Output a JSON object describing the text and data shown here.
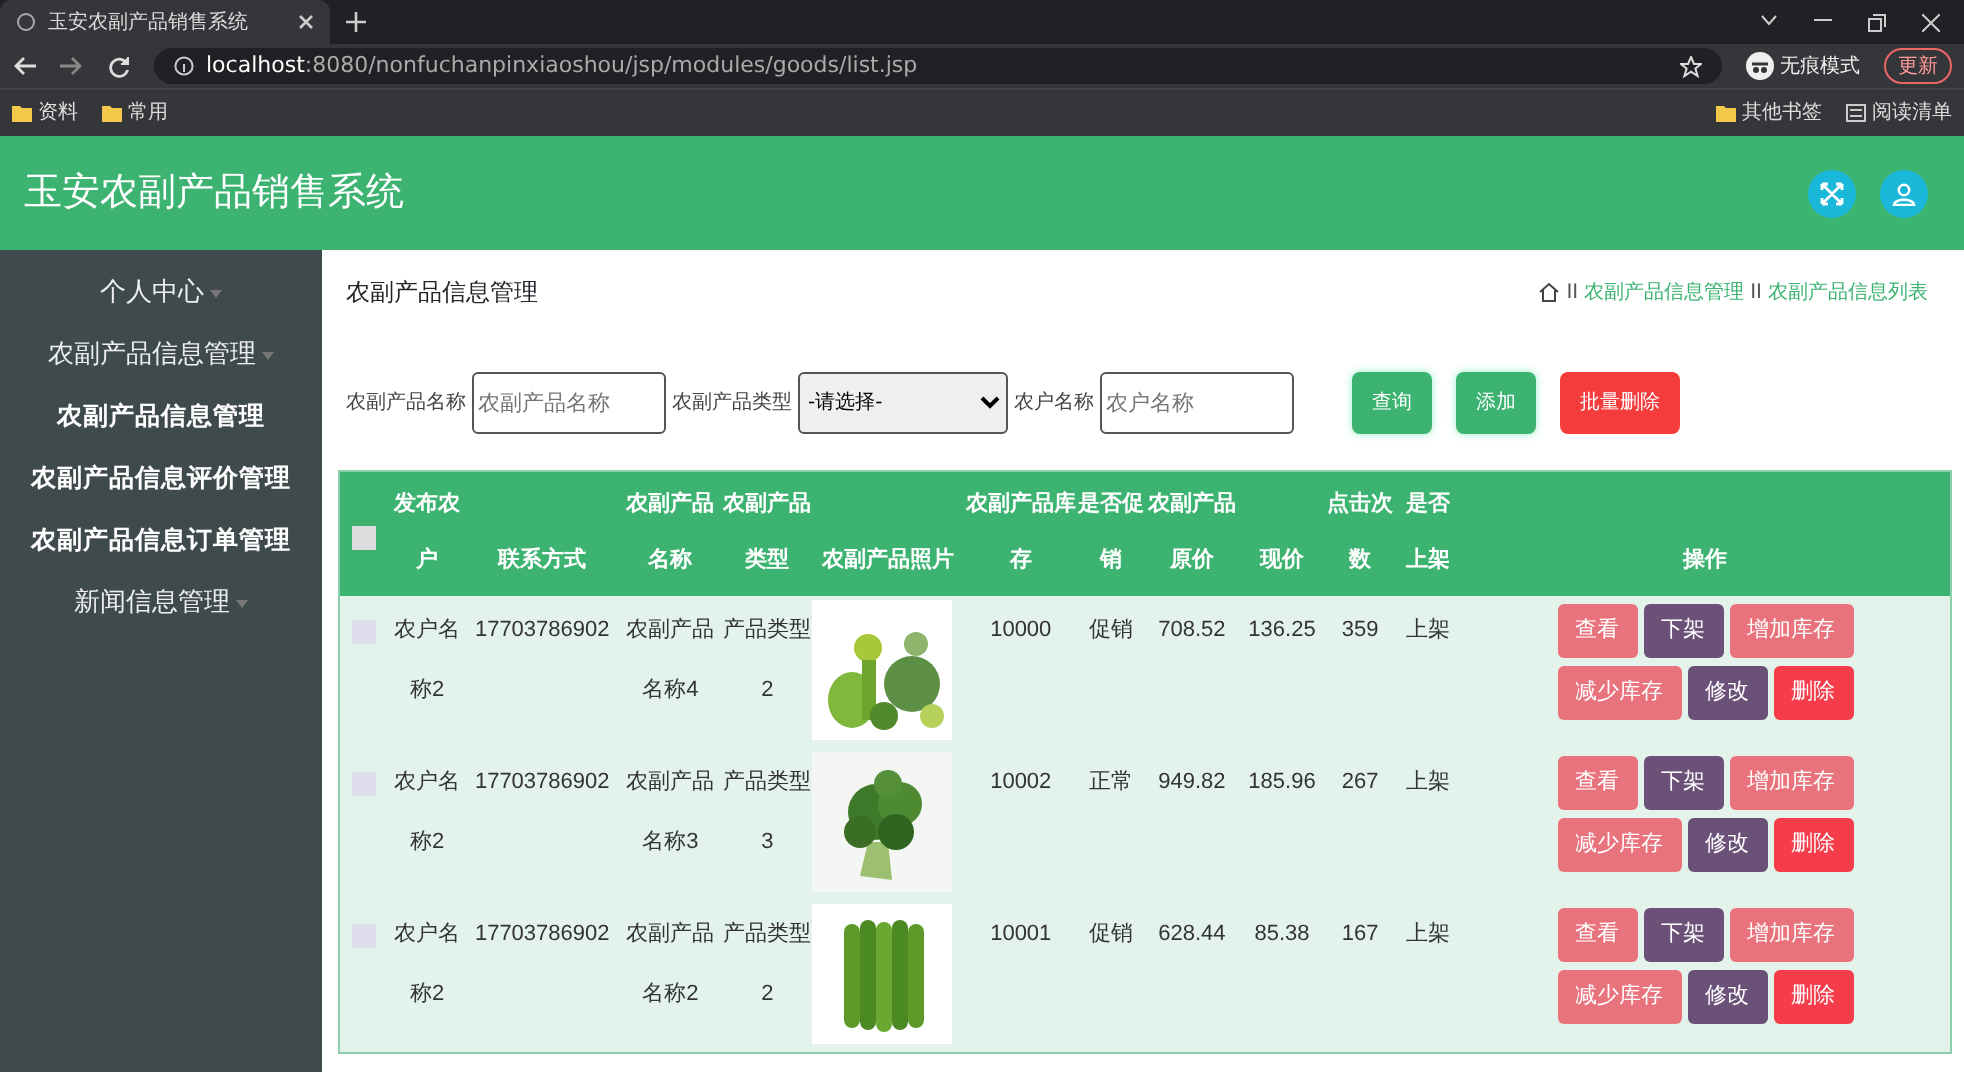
{
  "browser": {
    "tab_title": "玉安农副产品销售系统",
    "url_host": "localhost",
    "url_rest": ":8080/nonfuchanpinxiaoshou/jsp/modules/goods/list.jsp",
    "incognito": "无痕模式",
    "update": "更新",
    "bookmarks": [
      "资料",
      "常用"
    ],
    "bookmarks_right": [
      "其他书签",
      "阅读清单"
    ]
  },
  "header": {
    "title": "玉安农副产品销售系统"
  },
  "sidebar": {
    "items": [
      {
        "label": "个人中心",
        "kind": "group"
      },
      {
        "label": "农副产品信息管理",
        "kind": "group"
      },
      {
        "label": "农副产品信息管理",
        "kind": "sub"
      },
      {
        "label": "农副产品信息评价管理",
        "kind": "sub"
      },
      {
        "label": "农副产品信息订单管理",
        "kind": "sub"
      },
      {
        "label": "新闻信息管理",
        "kind": "group"
      }
    ]
  },
  "page": {
    "title": "农副产品信息管理",
    "breadcrumb": [
      {
        "separator": "II",
        "label": "农副产品信息管理"
      },
      {
        "separator": "II",
        "label": "农副产品信息列表"
      }
    ]
  },
  "filters": [
    {
      "label": "农副产品名称",
      "kind": "input",
      "placeholder": "农副产品名称"
    },
    {
      "label": "农副产品类型",
      "kind": "select",
      "value": "-请选择-"
    },
    {
      "label": "农户名称",
      "kind": "input",
      "placeholder": "农户名称"
    }
  ],
  "buttons": [
    {
      "label": "查询",
      "kind": "green"
    },
    {
      "label": "添加",
      "kind": "green"
    },
    {
      "label": "批量删除",
      "kind": "red"
    }
  ],
  "table": {
    "select_all_checked": false,
    "columns": [
      "发布农户",
      "联系方式",
      "农副产品名称",
      "农副产品类型",
      "农副产品照片",
      "农副产品库存",
      "是否促销",
      "农副产品原价",
      "现价",
      "点击次数",
      "是否上架",
      "操作"
    ],
    "rows": [
      {
        "checked": false,
        "cells": [
          "农户名称2",
          "17703786902",
          "农副产品名称4",
          "产品类型2",
          {
            "kind": "picture"
          },
          "10000",
          "促销",
          "708.52",
          "136.25",
          "359",
          "上架"
        ],
        "actions": [
          {
            "label": "查看",
            "kind": "pink"
          },
          {
            "label": "下架",
            "kind": "purple"
          },
          {
            "label": "增加库存",
            "kind": "pink"
          },
          {
            "label": "减少库存",
            "kind": "pink"
          },
          {
            "label": "修改",
            "kind": "purple"
          },
          {
            "label": "删除",
            "kind": "red"
          }
        ]
      },
      {
        "checked": false,
        "cells": [
          "农户名称2",
          "17703786902",
          "农副产品名称3",
          "产品类型3",
          {
            "kind": "picture"
          },
          "10002",
          "正常",
          "949.82",
          "185.96",
          "267",
          "上架"
        ],
        "actions": [
          {
            "label": "查看",
            "kind": "pink"
          },
          {
            "label": "下架",
            "kind": "purple"
          },
          {
            "label": "增加库存",
            "kind": "pink"
          },
          {
            "label": "减少库存",
            "kind": "pink"
          },
          {
            "label": "修改",
            "kind": "purple"
          },
          {
            "label": "删除",
            "kind": "red"
          }
        ]
      },
      {
        "checked": false,
        "cells": [
          "农户名称2",
          "17703786902",
          "农副产品名称2",
          "产品类型2",
          {
            "kind": "picture"
          },
          "10001",
          "促销",
          "628.44",
          "85.38",
          "167",
          "上架"
        ],
        "actions": [
          {
            "label": "查看",
            "kind": "pink"
          },
          {
            "label": "下架",
            "kind": "purple"
          },
          {
            "label": "增加库存",
            "kind": "pink"
          },
          {
            "label": "减少库存",
            "kind": "pink"
          },
          {
            "label": "修改",
            "kind": "purple"
          },
          {
            "label": "删除",
            "kind": "red"
          }
        ]
      }
    ]
  }
}
